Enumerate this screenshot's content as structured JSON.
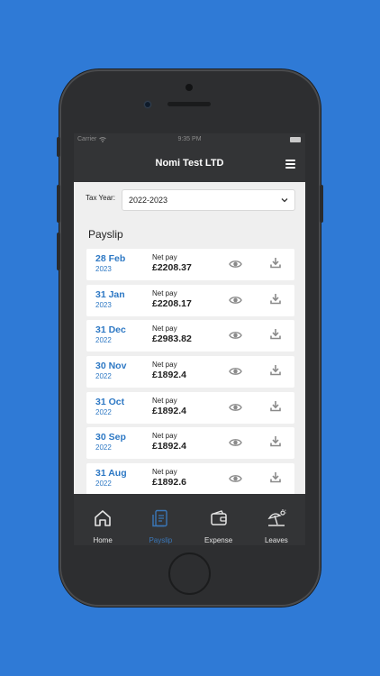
{
  "status": {
    "carrier": "Carrier",
    "time": "9:35 PM"
  },
  "header": {
    "title": "Nomi Test LTD",
    "menu_icon": "hamburger-menu-icon"
  },
  "tax_year": {
    "label": "Tax Year:",
    "value": "2022-2023"
  },
  "section_title": "Payslip",
  "payslips": [
    {
      "day_month": "28 Feb",
      "year": "2023",
      "net_label": "Net pay",
      "amount": "£2208.37"
    },
    {
      "day_month": "31 Jan",
      "year": "2023",
      "net_label": "Net pay",
      "amount": "£2208.17"
    },
    {
      "day_month": "31 Dec",
      "year": "2022",
      "net_label": "Net pay",
      "amount": "£2983.82"
    },
    {
      "day_month": "30 Nov",
      "year": "2022",
      "net_label": "Net pay",
      "amount": "£1892.4"
    },
    {
      "day_month": "31 Oct",
      "year": "2022",
      "net_label": "Net pay",
      "amount": "£1892.4"
    },
    {
      "day_month": "30 Sep",
      "year": "2022",
      "net_label": "Net pay",
      "amount": "£1892.4"
    },
    {
      "day_month": "31 Aug",
      "year": "2022",
      "net_label": "Net pay",
      "amount": "£1892.6"
    }
  ],
  "tabs": [
    {
      "label": "Home",
      "icon": "home-icon",
      "active": false
    },
    {
      "label": "Payslip",
      "icon": "payslip-icon",
      "active": true
    },
    {
      "label": "Expense",
      "icon": "wallet-icon",
      "active": false
    },
    {
      "label": "Leaves",
      "icon": "beach-umbrella-icon",
      "active": false
    }
  ],
  "colors": {
    "background": "#2f7ad6",
    "nav_bar": "#333436",
    "accent_blue": "#2d78c4",
    "active_tab": "#3a77b8",
    "screen_bg": "#efefef"
  }
}
